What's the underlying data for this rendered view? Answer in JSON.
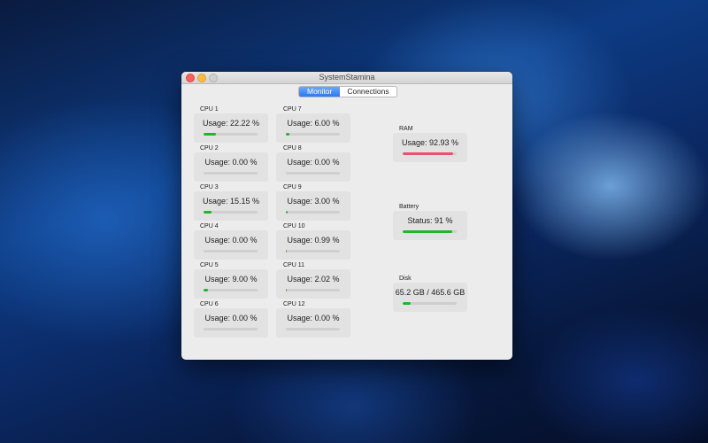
{
  "window": {
    "title": "SystemStamina"
  },
  "tabs": {
    "monitor": "Monitor",
    "connections": "Connections"
  },
  "cpus": [
    {
      "label": "CPU 1",
      "text": "Usage: 22.22 %",
      "value": 0.2222
    },
    {
      "label": "CPU 2",
      "text": "Usage: 0.00 %",
      "value": 0.0
    },
    {
      "label": "CPU 3",
      "text": "Usage: 15.15 %",
      "value": 0.1515
    },
    {
      "label": "CPU 4",
      "text": "Usage: 0.00 %",
      "value": 0.0
    },
    {
      "label": "CPU 5",
      "text": "Usage: 9.00 %",
      "value": 0.09
    },
    {
      "label": "CPU 6",
      "text": "Usage: 0.00 %",
      "value": 0.0
    },
    {
      "label": "CPU 7",
      "text": "Usage: 6.00 %",
      "value": 0.06
    },
    {
      "label": "CPU 8",
      "text": "Usage: 0.00 %",
      "value": 0.0
    },
    {
      "label": "CPU 9",
      "text": "Usage: 3.00 %",
      "value": 0.03
    },
    {
      "label": "CPU 10",
      "text": "Usage: 0.99 %",
      "value": 0.0099
    },
    {
      "label": "CPU 11",
      "text": "Usage: 2.02 %",
      "value": 0.0202
    },
    {
      "label": "CPU 12",
      "text": "Usage: 0.00 %",
      "value": 0.0
    }
  ],
  "ram": {
    "label": "RAM",
    "text": "Usage: 92.93 %",
    "value": 0.9293
  },
  "battery": {
    "label": "Battery",
    "text": "Status: 91 %",
    "value": 0.91
  },
  "disk": {
    "label": "Disk",
    "text": "65.2 GB / 465.6 GB",
    "value": 0.14
  },
  "colors": {
    "green": "#21b527",
    "red": "#e8516e",
    "accent": "#2a79f5"
  }
}
